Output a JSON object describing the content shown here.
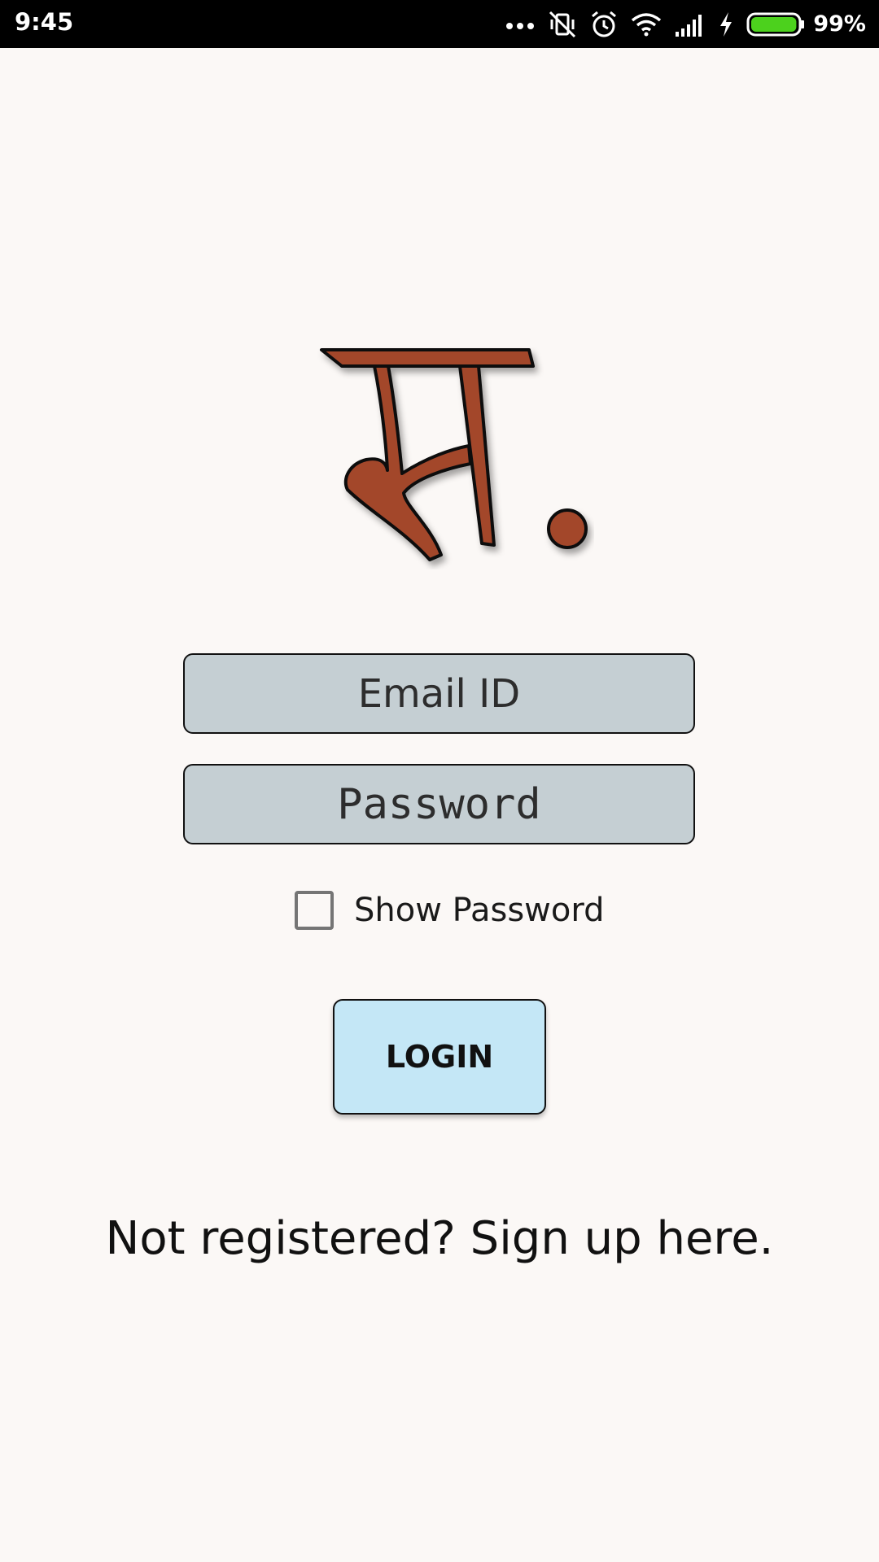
{
  "status_bar": {
    "time": "9:45",
    "battery_percent": "99%",
    "battery_level": 0.99,
    "icons": [
      "more-dots-icon",
      "vibrate-off-icon",
      "alarm-icon",
      "wifi-icon",
      "signal-icon",
      "charging-icon",
      "battery-icon"
    ],
    "colors": {
      "background": "#000000",
      "battery_fill": "#4cd11d"
    }
  },
  "logo": {
    "glyph": "स",
    "colors": {
      "fill": "#a3462c",
      "outline": "#111111"
    }
  },
  "login_form": {
    "email_placeholder": "Email ID",
    "email_value": "",
    "password_placeholder": "Password",
    "password_value": "",
    "show_password_label": "Show Password",
    "show_password_checked": false,
    "login_label": "LOGIN",
    "colors": {
      "field_bg": "#c5cfd3",
      "button_bg": "#c4e7f6",
      "page_bg": "#fbf8f6"
    }
  },
  "signup_link": "Not registered? Sign up here."
}
